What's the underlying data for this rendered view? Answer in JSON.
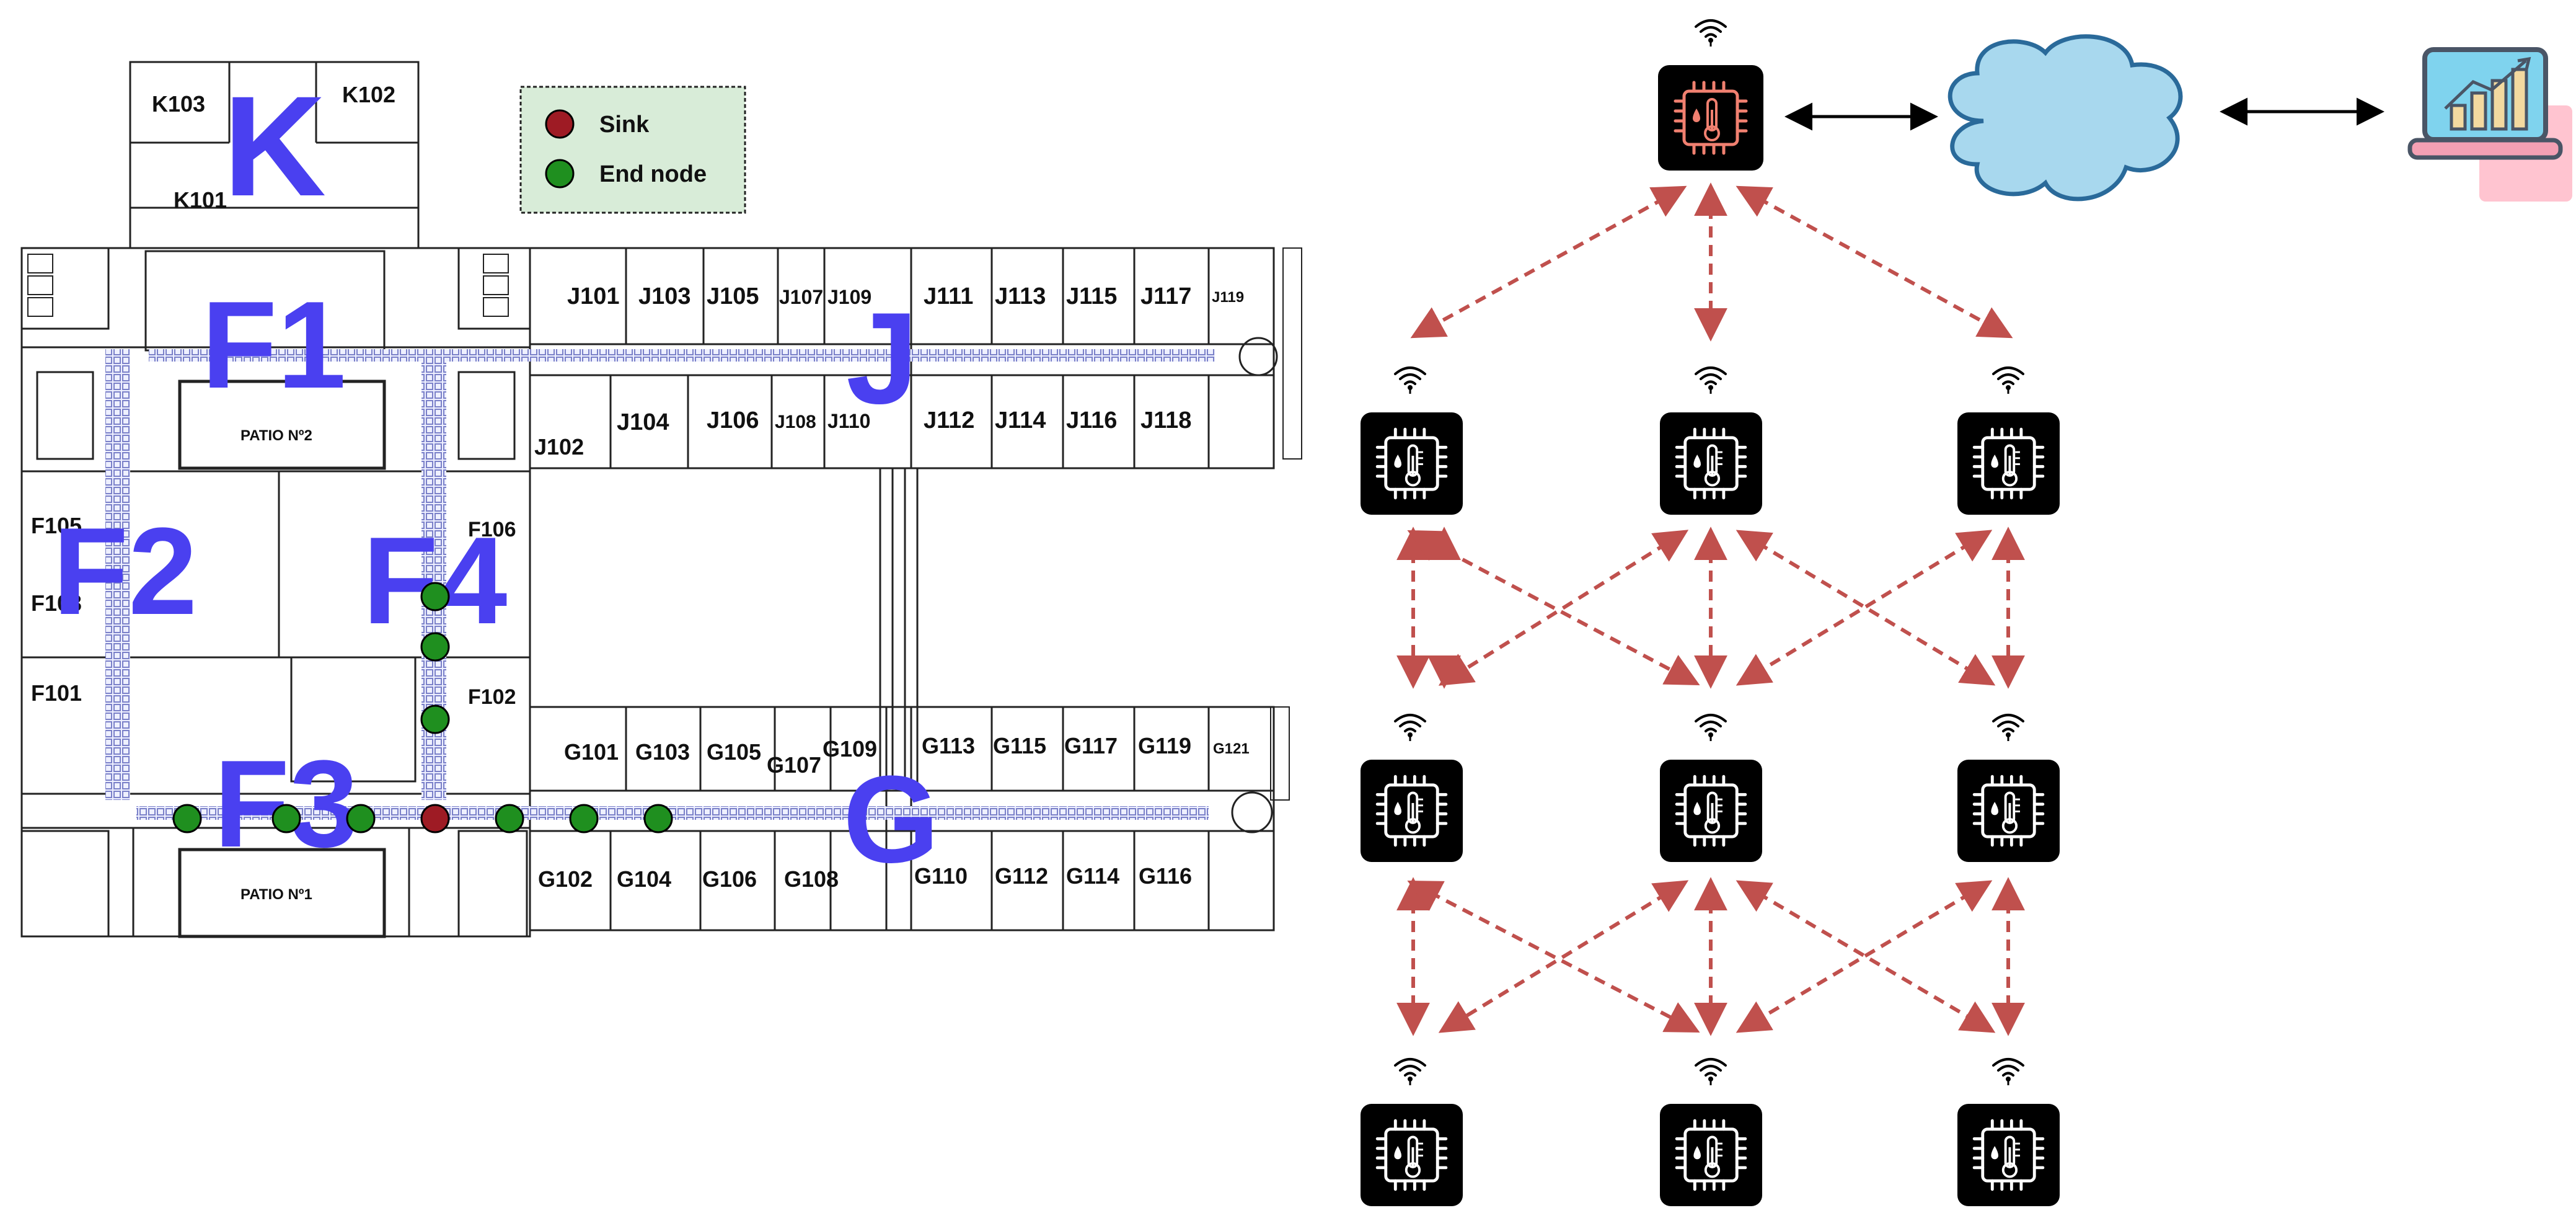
{
  "legend": {
    "sink_label": "Sink",
    "end_node_label": "End node",
    "sink_color": "#9e1b24",
    "end_node_color": "#1f8f1f"
  },
  "zones": {
    "k": "K",
    "f1": "F1",
    "f2": "F2",
    "f3": "F3",
    "f4": "F4",
    "j": "J",
    "g": "G"
  },
  "rooms": {
    "k103": "K103",
    "k102": "K102",
    "k101": "K101",
    "j101": "J101",
    "j103": "J103",
    "j105": "J105",
    "j107": "J107",
    "j109": "J109",
    "j111": "J111",
    "j113": "J113",
    "j115": "J115",
    "j117": "J117",
    "j119": "J119",
    "j102": "J102",
    "j104": "J104",
    "j106": "J106",
    "j108": "J108",
    "j110": "J110",
    "j112": "J112",
    "j114": "J114",
    "j116": "J116",
    "j118": "J118",
    "f105": "F105",
    "f103": "F103",
    "f101": "F101",
    "f106": "F106",
    "f102": "F102",
    "g101": "G101",
    "g103": "G103",
    "g105": "G105",
    "g107": "G107",
    "g109": "G109",
    "g113": "G113",
    "g115": "G115",
    "g117": "G117",
    "g119": "G119",
    "g121": "G121",
    "g102": "G102",
    "g104": "G104",
    "g106": "G106",
    "g108": "G108",
    "g110": "G110",
    "g112": "G112",
    "g114": "G114",
    "g116": "G116",
    "patio2": "PATIO Nº2",
    "patio1": "PATIO Nº1"
  },
  "colors": {
    "zone_label": "#4a40f0",
    "arrow_dashed": "#c0504d",
    "cloud_fill": "#a8d8ee",
    "cloud_stroke": "#2a6a9a",
    "gateway_sensor_tint": "#f08070"
  },
  "icons": {
    "sensor": "microchip-thermometer-icon",
    "gateway": "microchip-thermometer-gateway-icon",
    "cloud": "cloud-icon",
    "dashboard": "laptop-chart-icon"
  }
}
